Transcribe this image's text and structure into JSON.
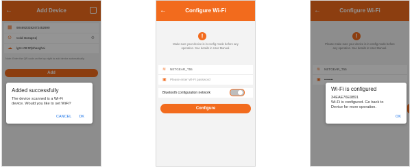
{
  "screen1": {
    "title": "Add Device",
    "rows": [
      {
        "icon": "qr-code-icon",
        "text": "9046923382472452690"
      },
      {
        "icon": "pin-icon",
        "text": "Cold storage1|"
      },
      {
        "icon": "cloud-icon",
        "text": "lgr4+08:00|shanghai"
      }
    ],
    "note": "Note: Enter the QR code on the top right to add device automatically.",
    "add_label": "Add",
    "dialog": {
      "title": "Added successfully",
      "message_line1": "The device scanned is a Wi-Fi",
      "message_line2": "device. Would you like to set WiFi?",
      "cancel": "CANCEL",
      "ok": "OK"
    }
  },
  "screen2": {
    "title": "Configure Wi-Fi",
    "message_line1": "Make sure your device is in config mode before any",
    "message_line2": "operation. See details in User Manual.",
    "ssid": "NETGEAR_T55",
    "password_placeholder": "Please enter Wi-Fi password",
    "bluetooth_label": "Bluetooth configuration network",
    "configure_label": "Configure"
  },
  "screen3": {
    "title": "Configure Wi-Fi",
    "message_line1": "Please make sure your device is in config mode before",
    "message_line2": "any operation. See details in User Manual.",
    "ssid": "NETGEAR_T55",
    "password": "••••••••",
    "dialog": {
      "title": "Wi-Fi is configured",
      "device_id": "34EAE76E9891",
      "message_line1": "Wi-Fi is configured. Go back to",
      "message_line2": "Device for more operation.",
      "ok": "OK"
    }
  },
  "colors": {
    "accent": "#f26b1d",
    "link": "#1a73e8"
  }
}
